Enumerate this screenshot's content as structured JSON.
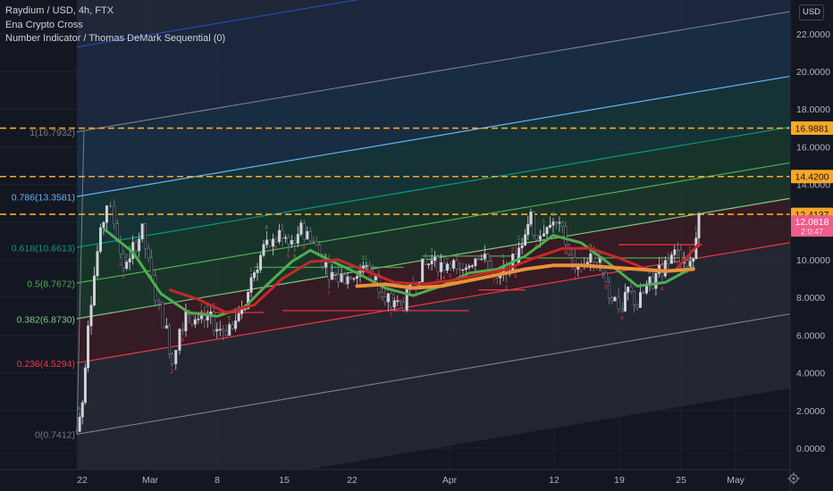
{
  "legend": {
    "symbol_line": "Raydium / USD, 4h, FTX",
    "indicator_1": "Ena Crypto Cross",
    "indicator_2": "Number Indicator / Thomas DeMark Sequential (0)"
  },
  "currency_label": "USD",
  "chart_data": {
    "type": "candlestick",
    "title": "Raydium / USD, 4h, FTX",
    "x_ticks": [
      "22",
      "Mar",
      "8",
      "15",
      "22",
      "Apr",
      "12",
      "19",
      "25",
      "May"
    ],
    "y_ticks": [
      "0.0000",
      "2.0000",
      "4.0000",
      "6.0000",
      "8.0000",
      "10.0000",
      "12.0000",
      "14.0000",
      "16.0000",
      "18.0000",
      "20.0000",
      "22.0000"
    ],
    "ylim": [
      -1.2,
      24.5
    ],
    "y_scale": "linear",
    "grid": true,
    "fib_channel_levels": [
      {
        "ratio": "0",
        "label": "0(0.7412)",
        "value": 0.7412,
        "color": "#787b86"
      },
      {
        "ratio": "0.236",
        "label": "0.236(4.5294)",
        "value": 4.5294,
        "color": "#f23645"
      },
      {
        "ratio": "0.382",
        "label": "0.382(6.8730)",
        "value": 6.873,
        "color": "#81c784"
      },
      {
        "ratio": "0.5",
        "label": "0.5(8.7672)",
        "value": 8.7672,
        "color": "#4caf50"
      },
      {
        "ratio": "0.618",
        "label": "0.618(10.6613)",
        "value": 10.6613,
        "color": "#089981"
      },
      {
        "ratio": "0.786",
        "label": "0.786(13.3581)",
        "value": 13.3581,
        "color": "#64b5f6"
      },
      {
        "ratio": "1",
        "label": "1(16.7932)",
        "value": 16.7932,
        "color": "#787b86"
      }
    ],
    "horizontal_levels": [
      {
        "value": 16.9881,
        "label": "16.9881",
        "color": "#f9a825"
      },
      {
        "value": 14.42,
        "label": "14.4200",
        "color": "#f9a825"
      },
      {
        "value": 12.4137,
        "label": "12.4137",
        "color": "#f9a825"
      }
    ],
    "last_price": {
      "value": 12.0818,
      "label": "12.0818",
      "countdown": "2:0:47",
      "color": "#f05c8c"
    },
    "price_series": [
      [
        0.0,
        0.9
      ],
      [
        0.6,
        2.5
      ],
      [
        1.2,
        6.8
      ],
      [
        2.2,
        10.4
      ],
      [
        3.2,
        13.0
      ],
      [
        4.0,
        12.0
      ],
      [
        5.0,
        9.6
      ],
      [
        6.0,
        10.6
      ],
      [
        7.0,
        11.5
      ],
      [
        8.0,
        8.9
      ],
      [
        8.8,
        7.4
      ],
      [
        9.6,
        6.2
      ],
      [
        10.2,
        4.6
      ],
      [
        11.0,
        6.4
      ],
      [
        12.0,
        7.2
      ],
      [
        13.0,
        6.5
      ],
      [
        14.0,
        7.0
      ],
      [
        15.0,
        6.4
      ],
      [
        16.0,
        6.3
      ],
      [
        17.0,
        7.0
      ],
      [
        18.0,
        7.7
      ],
      [
        19.0,
        9.4
      ],
      [
        20.0,
        10.6
      ],
      [
        21.0,
        10.9
      ],
      [
        22.0,
        11.5
      ],
      [
        23.0,
        11.0
      ],
      [
        24.0,
        11.6
      ],
      [
        25.0,
        11.3
      ],
      [
        26.0,
        10.3
      ],
      [
        27.0,
        9.4
      ],
      [
        28.0,
        9.0
      ],
      [
        29.0,
        9.1
      ],
      [
        30.0,
        9.2
      ],
      [
        31.0,
        9.6
      ],
      [
        32.0,
        9.0
      ],
      [
        33.0,
        8.2
      ],
      [
        34.0,
        7.5
      ],
      [
        35.0,
        7.7
      ],
      [
        36.0,
        8.6
      ],
      [
        37.0,
        9.6
      ],
      [
        38.0,
        9.9
      ],
      [
        39.0,
        9.6
      ],
      [
        40.0,
        10.0
      ],
      [
        41.0,
        9.2
      ],
      [
        42.0,
        9.8
      ],
      [
        43.0,
        10.4
      ],
      [
        44.0,
        9.8
      ],
      [
        45.0,
        8.7
      ],
      [
        46.0,
        9.6
      ],
      [
        47.0,
        10.1
      ],
      [
        48.0,
        11.6
      ],
      [
        48.6,
        12.3
      ],
      [
        49.2,
        11.0
      ],
      [
        50.0,
        11.7
      ],
      [
        51.0,
        12.0
      ],
      [
        52.0,
        11.4
      ],
      [
        53.0,
        10.0
      ],
      [
        54.0,
        9.5
      ],
      [
        55.0,
        10.4
      ],
      [
        56.0,
        10.1
      ],
      [
        57.0,
        8.2
      ],
      [
        57.6,
        7.9
      ],
      [
        58.4,
        7.3
      ],
      [
        59.0,
        8.4
      ],
      [
        60.0,
        7.6
      ],
      [
        61.0,
        8.5
      ],
      [
        62.0,
        9.1
      ],
      [
        63.0,
        9.7
      ],
      [
        64.0,
        10.2
      ],
      [
        65.0,
        10.0
      ],
      [
        66.0,
        10.3
      ],
      [
        66.6,
        12.3
      ],
      [
        67.0,
        12.1
      ]
    ],
    "moving_averages": [
      {
        "name": "",
        "color": "#4caf50",
        "points": [
          [
            3,
            11.6
          ],
          [
            6,
            10.4
          ],
          [
            9,
            8.2
          ],
          [
            12,
            7.2
          ],
          [
            15,
            7.0
          ],
          [
            18,
            7.5
          ],
          [
            20,
            8.5
          ],
          [
            23,
            9.9
          ],
          [
            25,
            10.5
          ],
          [
            27,
            10.0
          ],
          [
            30,
            9.3
          ],
          [
            33,
            8.5
          ],
          [
            36,
            8.1
          ],
          [
            39,
            8.6
          ],
          [
            42,
            9.3
          ],
          [
            45,
            9.5
          ],
          [
            48,
            10.2
          ],
          [
            51,
            11.3
          ],
          [
            54,
            10.9
          ],
          [
            57,
            9.8
          ],
          [
            60,
            8.6
          ],
          [
            63,
            8.8
          ],
          [
            66,
            9.6
          ]
        ]
      },
      {
        "name": "",
        "color": "#c62828",
        "points": [
          [
            10,
            8.4
          ],
          [
            13,
            7.9
          ],
          [
            16,
            7.2
          ],
          [
            19,
            7.6
          ],
          [
            22,
            9.0
          ],
          [
            25,
            9.9
          ],
          [
            28,
            10.0
          ],
          [
            31,
            9.4
          ],
          [
            34,
            8.8
          ],
          [
            37,
            8.7
          ],
          [
            40,
            8.9
          ],
          [
            43,
            9.2
          ],
          [
            46,
            9.5
          ],
          [
            49,
            10.1
          ],
          [
            52,
            10.6
          ],
          [
            55,
            10.6
          ],
          [
            58,
            10.1
          ],
          [
            61,
            9.5
          ],
          [
            64,
            9.4
          ],
          [
            66.5,
            10.8
          ]
        ]
      },
      {
        "name": "",
        "color": "#e8923a",
        "points": [
          [
            30,
            8.6
          ],
          [
            33,
            8.7
          ],
          [
            36,
            8.5
          ],
          [
            39,
            8.6
          ],
          [
            42,
            8.9
          ],
          [
            45,
            9.2
          ],
          [
            48,
            9.5
          ],
          [
            51,
            9.7
          ],
          [
            54,
            9.7
          ],
          [
            57,
            9.6
          ],
          [
            60,
            9.5
          ],
          [
            63,
            9.4
          ],
          [
            66,
            9.5
          ]
        ]
      }
    ],
    "support_lines": [
      {
        "from": 12,
        "to": 20,
        "value": 7.2,
        "color": "#f23645"
      },
      {
        "from": 22,
        "to": 33,
        "value": 7.3,
        "color": "#f23645"
      },
      {
        "from": 33,
        "to": 42,
        "value": 7.3,
        "color": "#f23645"
      },
      {
        "from": 43,
        "to": 48,
        "value": 8.4,
        "color": "#f23645"
      },
      {
        "from": 19,
        "to": 35,
        "value": 9.6,
        "color": "#4caf50"
      },
      {
        "from": 37,
        "to": 47,
        "value": 10.2,
        "color": "#4caf50"
      },
      {
        "from": 47,
        "to": 66,
        "value": 10.1,
        "color": "#4caf50"
      },
      {
        "from": 58,
        "to": 67,
        "value": 10.8,
        "color": "#f23645"
      }
    ]
  }
}
